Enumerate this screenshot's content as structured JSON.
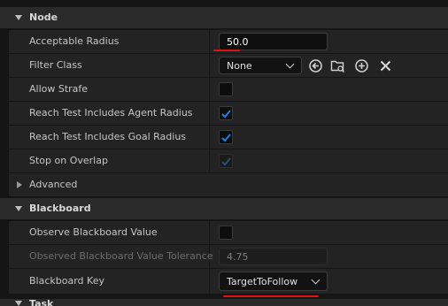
{
  "node": {
    "title": "Node",
    "acceptable_radius": {
      "label": "Acceptable Radius",
      "value": "50.0"
    },
    "filter_class": {
      "label": "Filter Class",
      "value": "None"
    },
    "allow_strafe": {
      "label": "Allow Strafe",
      "checked": false
    },
    "reach_agent": {
      "label": "Reach Test Includes Agent Radius",
      "checked": true
    },
    "reach_goal": {
      "label": "Reach Test Includes Goal Radius",
      "checked": true
    },
    "stop_overlap": {
      "label": "Stop on Overlap",
      "checked": true,
      "disabled": true
    },
    "advanced": {
      "label": "Advanced"
    }
  },
  "blackboard": {
    "title": "Blackboard",
    "observe": {
      "label": "Observe Blackboard Value",
      "checked": false
    },
    "tolerance": {
      "label": "Observed Blackboard Value Tolerance",
      "value": "4.75"
    },
    "key": {
      "label": "Blackboard Key",
      "value": "TargetToFollow"
    }
  },
  "task": {
    "title": "Task"
  },
  "colors": {
    "accent": "#1f7fe0",
    "annotation": "#d81414"
  }
}
